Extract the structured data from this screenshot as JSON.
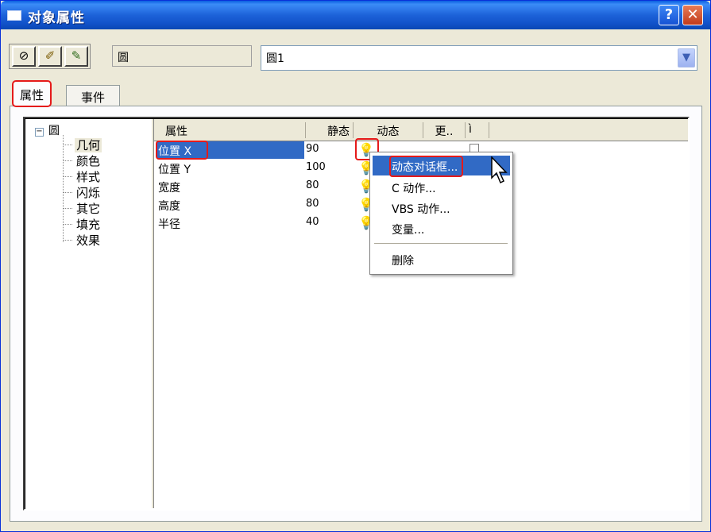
{
  "window": {
    "title": "对象属性",
    "help_label": "?",
    "close_label": "✕"
  },
  "toolbar": {
    "tool1_icon": "pin-icon",
    "tool2_icon": "pen-icon",
    "tool3_icon": "pen-check-icon"
  },
  "object": {
    "type": "圆",
    "name": "圆1"
  },
  "tabs": {
    "properties": "属性",
    "events": "事件"
  },
  "tree": {
    "root": "圆",
    "items": [
      "几何",
      "颜色",
      "样式",
      "闪烁",
      "其它",
      "填充",
      "效果"
    ],
    "selected": "几何"
  },
  "grid": {
    "headers": [
      "属性",
      "静态",
      "动态",
      "更..",
      "ì"
    ],
    "rows": [
      {
        "name": "位置 X",
        "static": "90"
      },
      {
        "name": "位置 Y",
        "static": "100"
      },
      {
        "name": "宽度",
        "static": "80"
      },
      {
        "name": "高度",
        "static": "80"
      },
      {
        "name": "半径",
        "static": "40"
      }
    ],
    "dynamic_icon": "lightbulb-icon"
  },
  "context_menu": {
    "items": [
      "动态对话框...",
      "C 动作...",
      "VBS 动作...",
      "变量..."
    ],
    "delete": "删除"
  }
}
